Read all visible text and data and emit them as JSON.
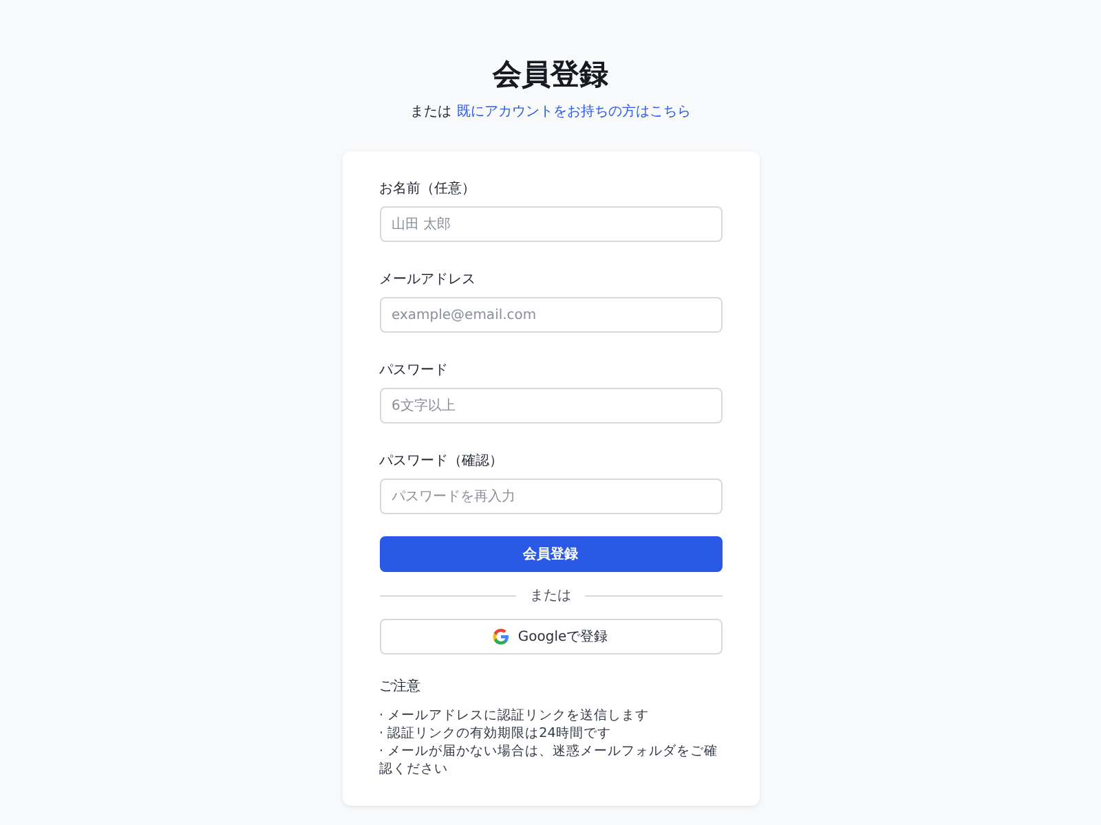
{
  "header": {
    "title": "会員登録",
    "prefix": "または",
    "login_link": "既にアカウントをお持ちの方はこちら"
  },
  "fields": [
    {
      "label": "お名前（任意）",
      "placeholder": "山田 太郎"
    },
    {
      "label": "メールアドレス",
      "placeholder": "example@email.com"
    },
    {
      "label": "パスワード",
      "placeholder": "6文字以上"
    },
    {
      "label": "パスワード（確認）",
      "placeholder": "パスワードを再入力"
    }
  ],
  "submit_button": "会員登録",
  "divider": "または",
  "google_button": "Googleで登録",
  "notes": {
    "title": "ご注意",
    "items": [
      "· メールアドレスに認証リンクを送信します",
      "· 認証リンクの有効期限は24時間です",
      "· メールが届かない場合は、迷惑メールフォルダをご確認ください"
    ]
  }
}
